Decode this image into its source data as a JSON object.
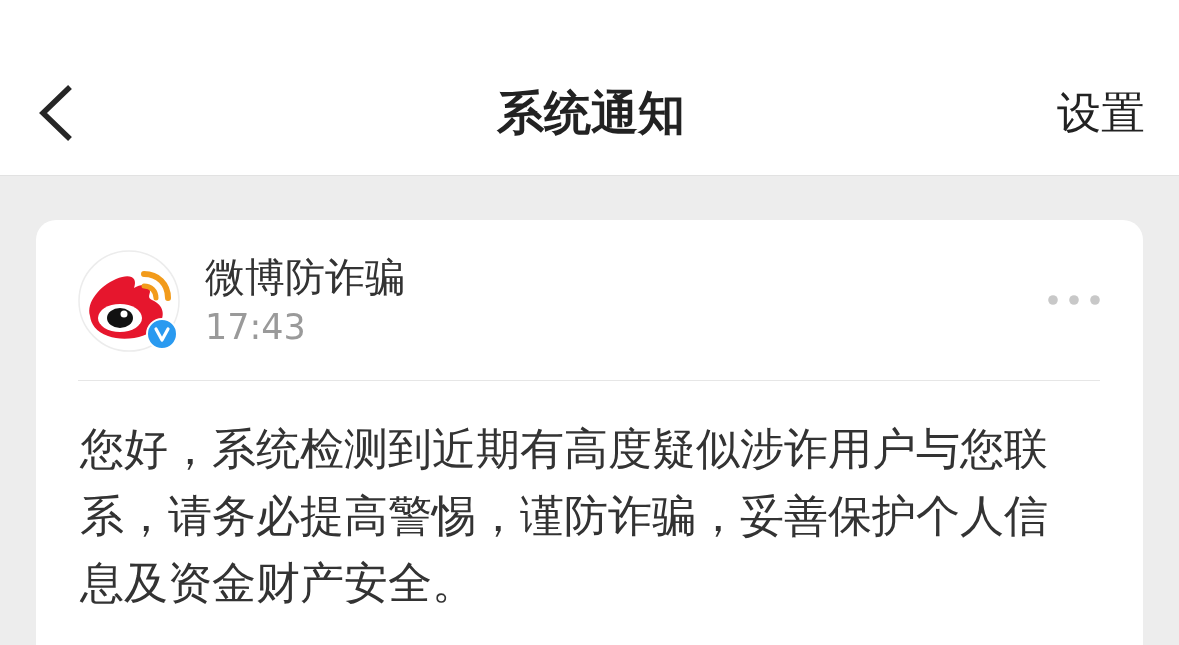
{
  "nav_bar": {
    "title": "系统通知",
    "action": "设置"
  },
  "notifications": [
    {
      "sender": "微博防诈骗",
      "verified": true,
      "time": "17:43",
      "message": "您好，系统检测到近期有高度疑似涉诈用户与您联系，请务必提高警惕，谨防诈骗，妥善保护个人信息及资金财产安全。"
    }
  ]
}
